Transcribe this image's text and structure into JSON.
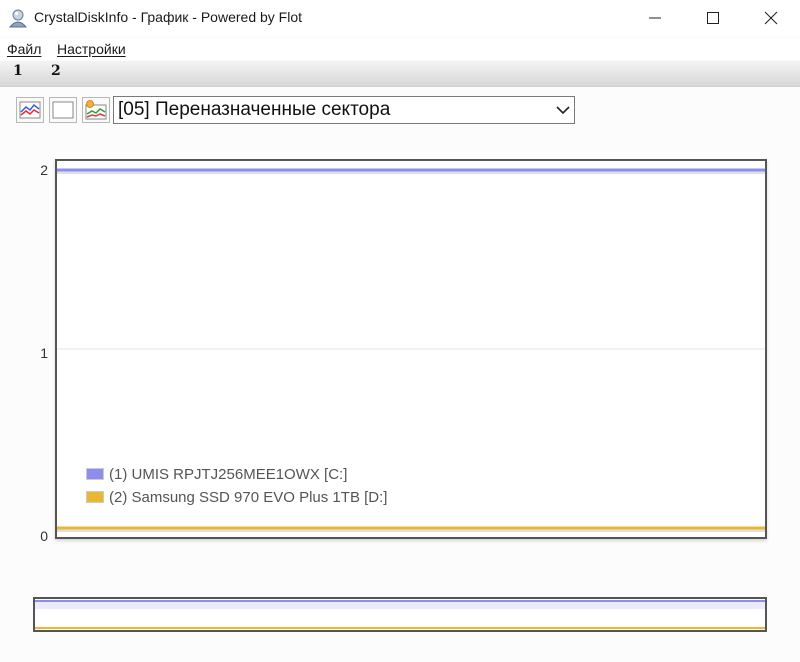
{
  "window": {
    "title": "CrystalDiskInfo - График - Powered by Flot",
    "minimize_icon": "minimize-icon",
    "maximize_icon": "maximize-icon",
    "close_icon": "close-icon"
  },
  "menu": {
    "items": [
      {
        "label": "Файл"
      },
      {
        "label": "Настройки"
      }
    ]
  },
  "tabs": [
    {
      "label": "1"
    },
    {
      "label": "2"
    }
  ],
  "toolbar": {
    "buttons": [
      "graph-all-icon",
      "graph-none-icon",
      "graph-custom-icon"
    ],
    "attribute_select": {
      "value": "[05] Переназначенные сектора"
    }
  },
  "chart_data": {
    "type": "line",
    "title": "",
    "xlabel": "",
    "ylabel": "",
    "ylim": [
      0,
      2
    ],
    "yticks": [
      "0",
      "1",
      "2"
    ],
    "grid": true,
    "legend_position": "bottom-left",
    "series": [
      {
        "name": "(1) UMIS RPJTJ256MEE1OWX [C:]",
        "color": "#8d8df0",
        "values": [
          2,
          2
        ]
      },
      {
        "name": "(2) Samsung SSD 970 EVO Plus 1TB [D:]",
        "color": "#e8b830",
        "values": [
          0,
          0
        ]
      }
    ]
  },
  "overview": {
    "series_colors": [
      "#8d8df0",
      "#e8b830"
    ]
  }
}
